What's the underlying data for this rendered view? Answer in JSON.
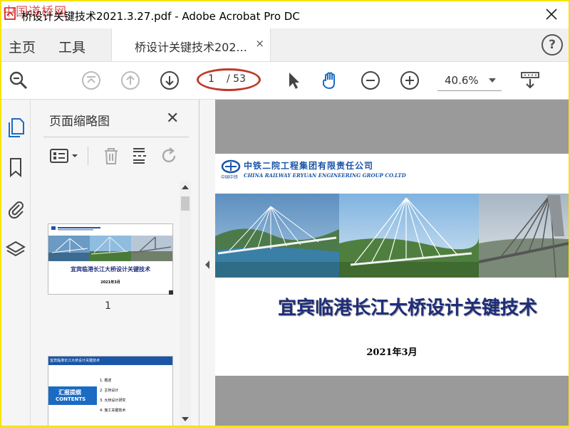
{
  "window": {
    "title": "桥设计关键技术2021.3.27.pdf - Adobe Acrobat Pro DC",
    "watermark": "中国道桥网"
  },
  "menu": {
    "home": "主页",
    "tools": "工具"
  },
  "tab": {
    "label": "桥设计关键技术202...",
    "close": "×"
  },
  "help": "?",
  "toolbar": {
    "current_page": "1",
    "total_pages": "/ 53",
    "zoom": "40.6%"
  },
  "panel": {
    "title": "页面缩略图",
    "close": "✕"
  },
  "thumbnails": [
    {
      "page_label": "1",
      "title": "宜宾临港长江大桥设计关键技术",
      "date": "2021年3月"
    },
    {
      "header": "宜宾临港长江大桥设计关键技术",
      "badge_cn": "汇报提纲",
      "badge_en": "CONTENTS",
      "outline": [
        "1.  概述",
        "2.  主桥设计",
        "3.  大桥设计研究",
        "4.  施工关键技术"
      ]
    }
  ],
  "document": {
    "company_cn": "中铁二院工程集团有限责任公司",
    "company_en": "CHINA RAILWAY ERYUAN ENGINEERING GROUP CO.LTD",
    "logo_caption": "中国中铁",
    "title": "宜宾临港长江大桥设计关键技术",
    "date": "2021年3月"
  },
  "colors": {
    "accent_blue": "#1f2d7a",
    "highlight_oval": "#c0392b",
    "frame": "#f5e400"
  }
}
